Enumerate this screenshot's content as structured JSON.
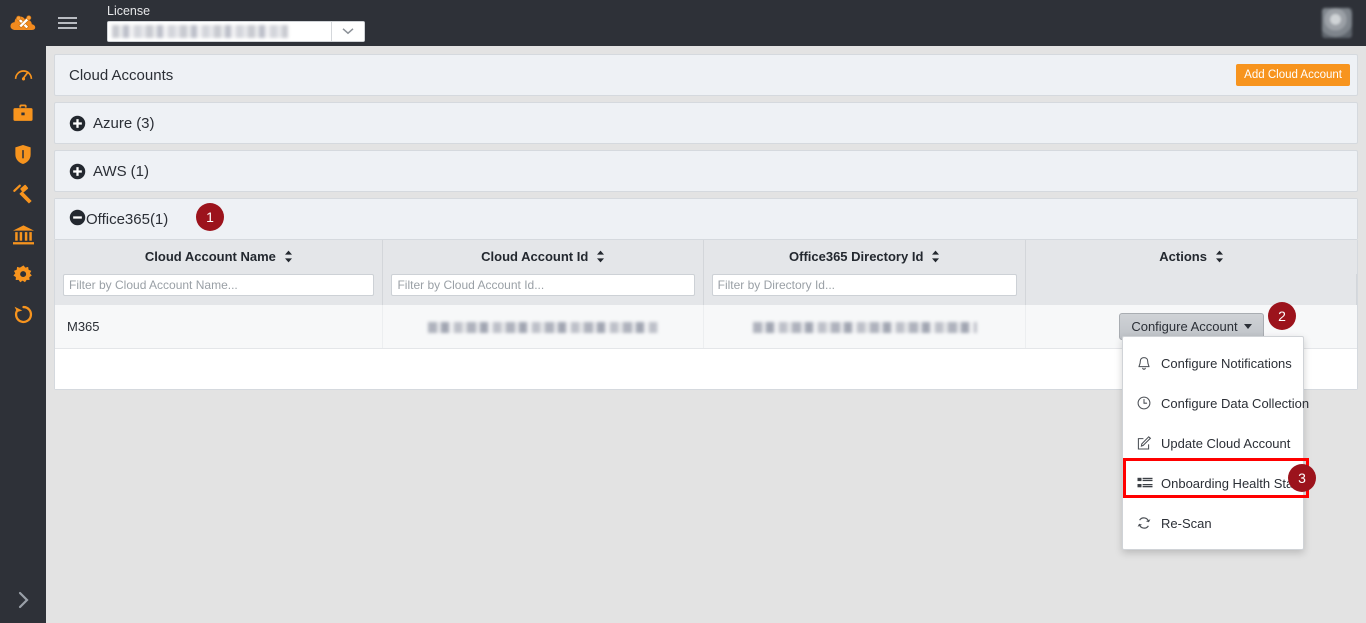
{
  "topbar": {
    "logo_icon": "cloud-tools-logo-icon",
    "hamburger_icon": "hamburger-menu-icon",
    "license_label": "License",
    "license_value": "",
    "license_value_redacted": true,
    "license_caret_icon": "chevron-down-icon",
    "avatar_icon": "user-avatar",
    "background_color": "#2e3138"
  },
  "sidebar": {
    "background_color": "#2e3138",
    "accent_color": "#f7941e",
    "expand_icon": "chevron-right-icon",
    "items": [
      {
        "icon": "dashboard-gauge-icon",
        "label": "Dashboard"
      },
      {
        "icon": "briefcase-icon",
        "label": "Business"
      },
      {
        "icon": "shield-icon",
        "label": "Security"
      },
      {
        "icon": "gavel-icon",
        "label": "Compliance"
      },
      {
        "icon": "bank-icon",
        "label": "Governance"
      },
      {
        "icon": "gear-icon",
        "label": "Settings"
      },
      {
        "icon": "history-icon",
        "label": "History"
      }
    ]
  },
  "header": {
    "title": "Cloud Accounts",
    "add_button_label": "Add Cloud Account",
    "add_button_color": "#f7941e"
  },
  "groups": [
    {
      "name": "Azure",
      "count": "(3)",
      "expanded": false,
      "toggle_icon": "plus-circle-icon"
    },
    {
      "name": "AWS",
      "count": "(1)",
      "expanded": false,
      "toggle_icon": "plus-circle-icon"
    },
    {
      "name": "Office365",
      "count": "(1)",
      "expanded": true,
      "toggle_icon": "minus-circle-icon"
    }
  ],
  "table": {
    "columns": [
      {
        "label": "Cloud Account Name",
        "sortable": true,
        "filter_placeholder": "Filter by Cloud Account Name..."
      },
      {
        "label": "Cloud Account Id",
        "sortable": true,
        "filter_placeholder": "Filter by Cloud Account Id..."
      },
      {
        "label": "Office365 Directory Id",
        "sortable": true,
        "filter_placeholder": "Filter by Directory Id..."
      },
      {
        "label": "Actions",
        "sortable": true,
        "filter_placeholder": ""
      }
    ],
    "sort_icon": "sort-updown-icon",
    "rows": [
      {
        "cloud_account_name": "M365",
        "cloud_account_id": "",
        "cloud_account_id_redacted": true,
        "directory_id": "",
        "directory_id_redacted": true,
        "action_button_label": "Configure Account"
      }
    ]
  },
  "dropdown": {
    "open": true,
    "items": [
      {
        "label": "Configure Notifications",
        "icon": "bell-icon"
      },
      {
        "label": "Configure Data Collection",
        "icon": "clock-icon"
      },
      {
        "label": "Update Cloud Account",
        "icon": "edit-square-icon"
      },
      {
        "label": "Onboarding Health Status",
        "icon": "list-bars-icon",
        "highlighted": true
      },
      {
        "label": "Re-Scan",
        "icon": "refresh-icon"
      }
    ]
  },
  "annotations": {
    "badge_color": "#9c131c",
    "highlight_color": "#ff0000",
    "badges": [
      {
        "number": "1",
        "target": "office365-group-header"
      },
      {
        "number": "2",
        "target": "configure-account-button"
      },
      {
        "number": "3",
        "target": "onboarding-health-status-menu-item"
      }
    ]
  }
}
